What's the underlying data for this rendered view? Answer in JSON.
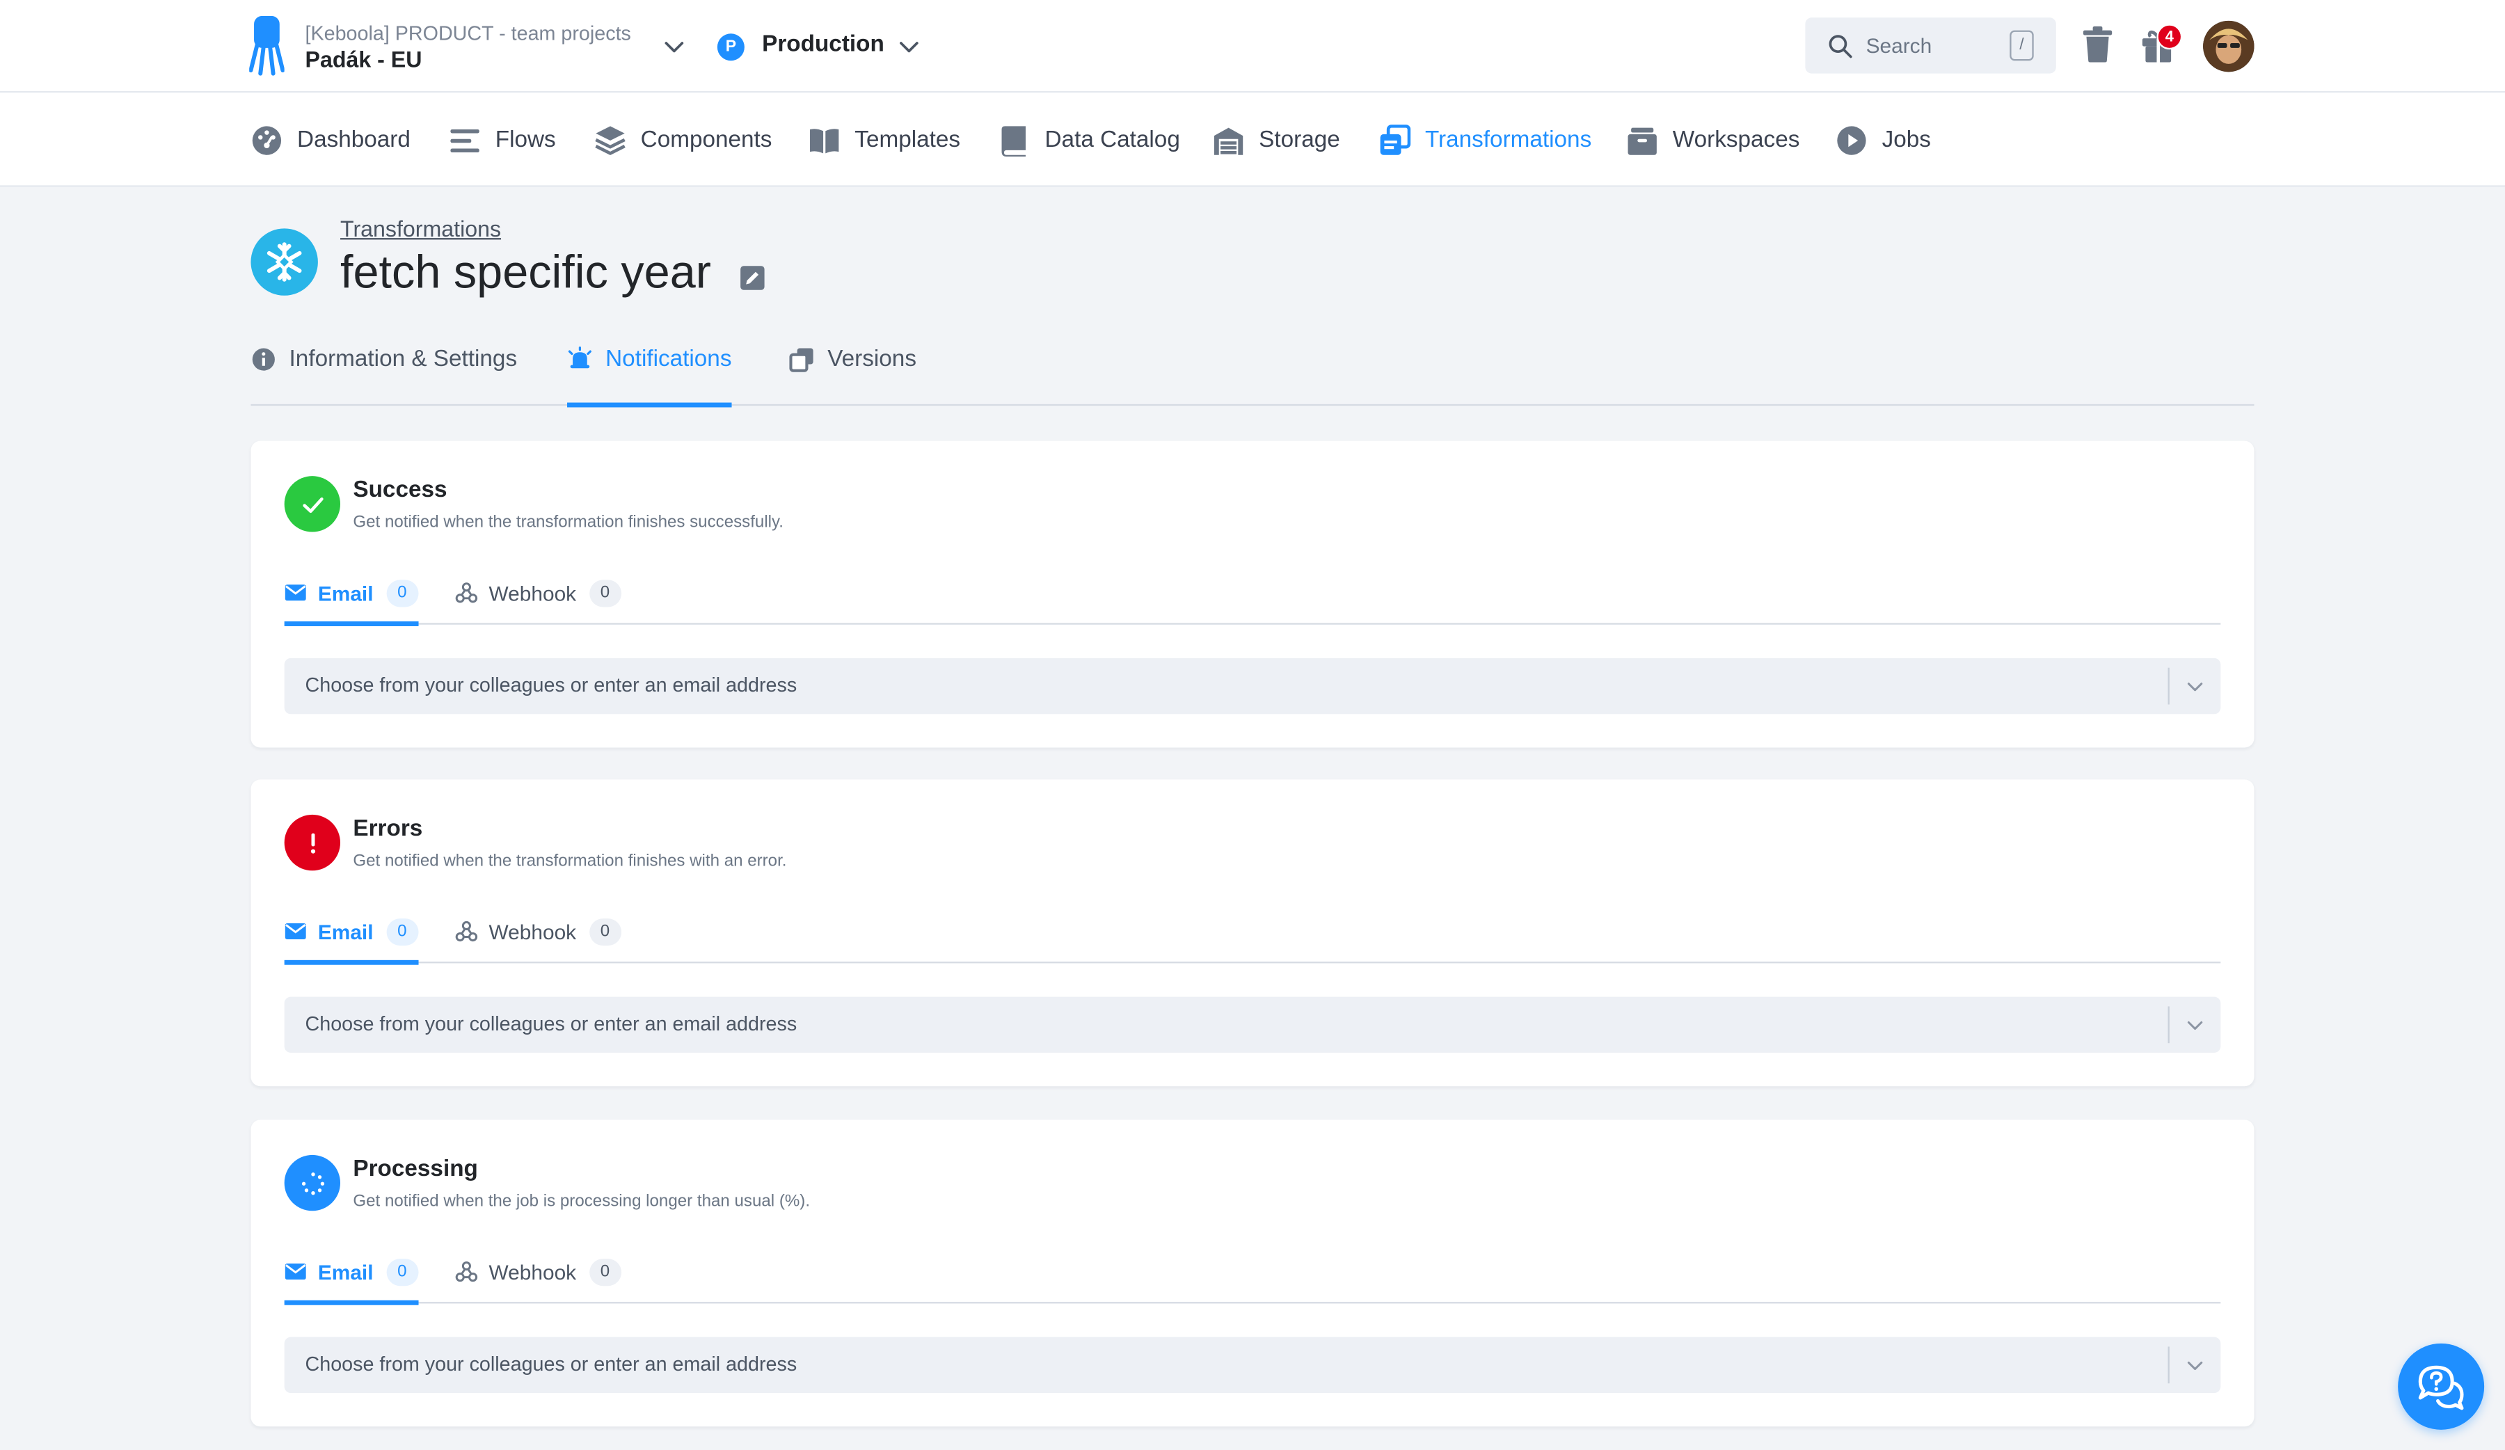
{
  "topbar": {
    "project_org": "[Keboola] PRODUCT - team projects",
    "project_name": "Padák - EU",
    "branch_initial": "P",
    "branch_name": "Production",
    "search_placeholder": "Search",
    "search_shortcut": "/",
    "notification_count": "4"
  },
  "nav": {
    "items": [
      {
        "label": "Dashboard",
        "icon": "dashboard-icon"
      },
      {
        "label": "Flows",
        "icon": "flows-icon"
      },
      {
        "label": "Components",
        "icon": "components-icon"
      },
      {
        "label": "Templates",
        "icon": "templates-icon"
      },
      {
        "label": "Data Catalog",
        "icon": "data-catalog-icon"
      },
      {
        "label": "Storage",
        "icon": "storage-icon"
      },
      {
        "label": "Transformations",
        "icon": "transformations-icon",
        "active": true
      },
      {
        "label": "Workspaces",
        "icon": "workspaces-icon"
      },
      {
        "label": "Jobs",
        "icon": "jobs-icon"
      }
    ]
  },
  "header": {
    "breadcrumb": "Transformations",
    "title": "fetch specific year"
  },
  "tabs": [
    {
      "label": "Information & Settings",
      "icon": "info-icon"
    },
    {
      "label": "Notifications",
      "icon": "bell-icon",
      "active": true
    },
    {
      "label": "Versions",
      "icon": "versions-icon"
    }
  ],
  "cards": [
    {
      "title": "Success",
      "description": "Get notified when the transformation finishes successfully.",
      "status_color": "#2AC940",
      "email_label": "Email",
      "email_count": "0",
      "webhook_label": "Webhook",
      "webhook_count": "0",
      "placeholder": "Choose from your colleagues or enter an email address"
    },
    {
      "title": "Errors",
      "description": "Get notified when the transformation finishes with an error.",
      "status_color": "#E0001B",
      "email_label": "Email",
      "email_count": "0",
      "webhook_label": "Webhook",
      "webhook_count": "0",
      "placeholder": "Choose from your colleagues or enter an email address"
    },
    {
      "title": "Processing",
      "description": "Get notified when the job is processing longer than usual (%).",
      "status_color": "#1F8FFF",
      "email_label": "Email",
      "email_count": "0",
      "webhook_label": "Webhook",
      "webhook_count": "0",
      "placeholder": "Choose from your colleagues or enter an email address"
    }
  ],
  "colors": {
    "accent": "#1F8FFF",
    "snowflake": "#29B5E8",
    "page_bg": "#F2F4F7"
  }
}
